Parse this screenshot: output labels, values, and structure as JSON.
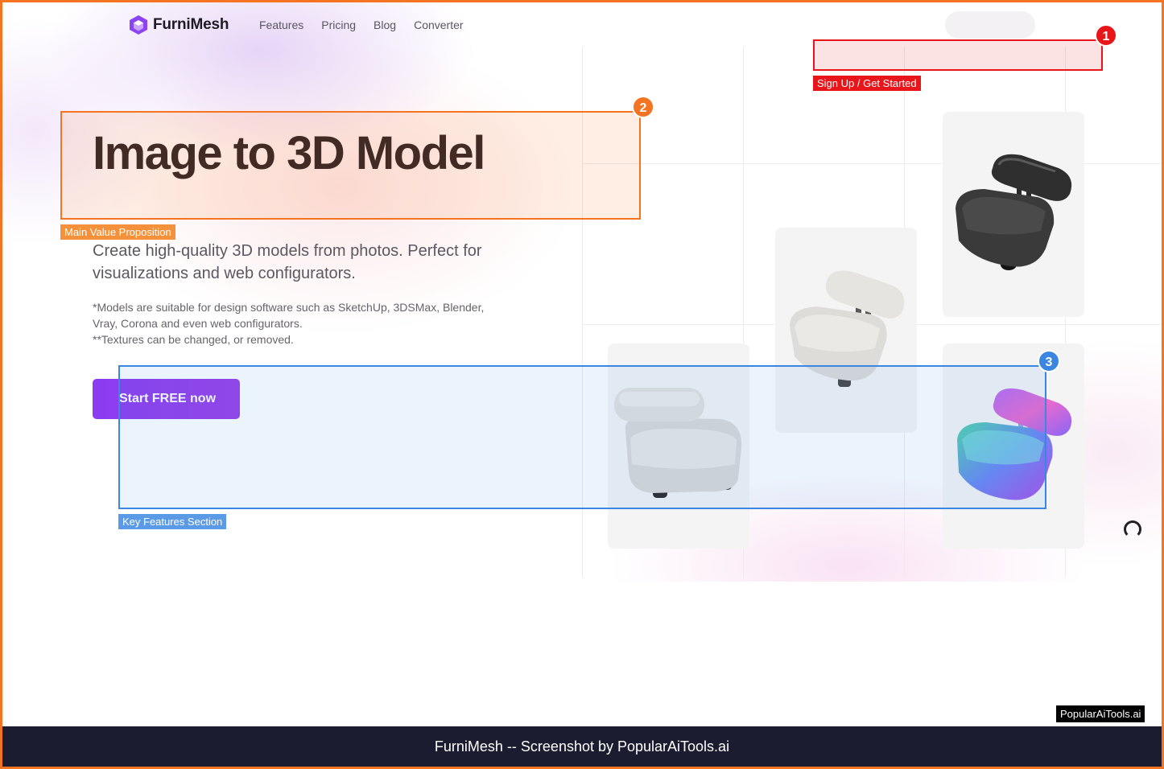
{
  "header": {
    "logo_text": "FurniMesh",
    "nav": [
      {
        "label": "Features"
      },
      {
        "label": "Pricing"
      },
      {
        "label": "Blog"
      },
      {
        "label": "Converter"
      }
    ]
  },
  "hero": {
    "title": "Image to 3D Model",
    "subtitle": "Create high-quality 3D models from photos. Perfect for visualizations and web configurators.",
    "note_1": "*Models are suitable for design software such as SketchUp, 3DSMax, Blender, Vray, Corona and even web configurators.",
    "note_2": "**Textures can be changed, or removed.",
    "cta_label": "Start FREE now"
  },
  "annotations": [
    {
      "number": "1",
      "label": "Sign Up / Get Started",
      "color": "#e8161b"
    },
    {
      "number": "2",
      "label": "Main Value Proposition",
      "color": "#f47421"
    },
    {
      "number": "3",
      "label": "Key Features Section",
      "color": "#3b86e0"
    }
  ],
  "watermark": {
    "badge": "PopularAiTools.ai"
  },
  "footer": {
    "caption": "FurniMesh -- Screenshot by PopularAiTools.ai"
  },
  "colors": {
    "accent": "#8b3cf0",
    "footer_bg": "#1b1c2f",
    "frame": "#f47421"
  },
  "icons": [
    "logo-icon",
    "loading-spinner-icon"
  ]
}
